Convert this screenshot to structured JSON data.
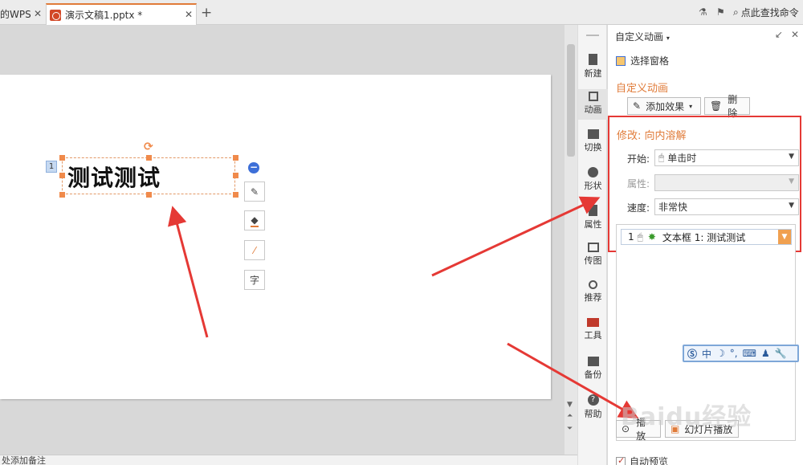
{
  "tabs": [
    {
      "label": "的WPS"
    },
    {
      "label": "演示文稿1.pptx *"
    }
  ],
  "search": {
    "label": "点此查找命令"
  },
  "slide": {
    "text": "测试测试",
    "anim_index": "1"
  },
  "strip": {
    "items": [
      {
        "label": "新建"
      },
      {
        "label": "动画"
      },
      {
        "label": "切换"
      },
      {
        "label": "形状"
      },
      {
        "label": "属性"
      },
      {
        "label": "传图"
      },
      {
        "label": "推荐"
      },
      {
        "label": "工具"
      },
      {
        "label": "备份"
      },
      {
        "label": "帮助"
      }
    ]
  },
  "panel": {
    "title": "自定义动画",
    "selection_pane": "选择窗格",
    "section_title": "自定义动画",
    "add_effect": "添加效果",
    "delete": "删除",
    "modify_title": "修改: 向内溶解",
    "start_label": "开始:",
    "start_value": "单击时",
    "property_label": "属性:",
    "speed_label": "速度:",
    "speed_value": "非常快",
    "anim_item": {
      "index": "1",
      "text": "文本框 1: 测试测试"
    },
    "ime_char": "中",
    "play": "播放",
    "slideshow": "幻灯片播放",
    "auto_preview": "自动预览"
  },
  "notes": {
    "placeholder": "处添加备注"
  },
  "watermark": "Baidu经验",
  "colors": {
    "accent": "#e07b39",
    "highlight_red": "#e53935"
  }
}
